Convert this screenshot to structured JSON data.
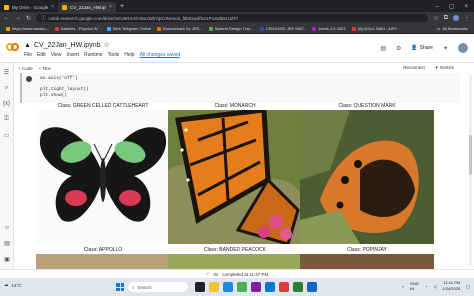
{
  "browser": {
    "tabs": [
      {
        "title": "My Drive - Google Drive",
        "active": false,
        "favicon_color": "#fbbc04"
      },
      {
        "title": "CV_22Jan_HW.ipynb - Colab",
        "active": true,
        "favicon_color": "#f9ab00"
      }
    ],
    "new_tab": "+",
    "url": "colab.research.google.com/drive/1KU6RXAD-Bsn3Zk7grL0Ne1ea_f8b0xwdfSn1P1swbB4UZFf",
    "bookmarks": [
      {
        "label": "https://www.amazo...",
        "color": "#ff9900"
      },
      {
        "label": "Batches - Physics W...",
        "color": "#e53935"
      },
      {
        "label": "Web Telegram Online",
        "color": "#29b6f6"
      },
      {
        "label": "Bounceback for JEE...",
        "color": "#ef6c00"
      },
      {
        "label": "System Design Tuto...",
        "color": "#4caf50"
      },
      {
        "label": "CENGAGE JEE MAT...",
        "color": "#3949ab"
      },
      {
        "label": "Jarvis 2.0 2023",
        "color": "#9c27b0"
      },
      {
        "label": "(8)(4)Su1-3d6rf - AIFF...",
        "color": "#e53935"
      }
    ],
    "all_bookmarks": "All Bookmarks"
  },
  "colab": {
    "notebook_title": "CV_22Jan_HW.ipynb",
    "menu": [
      "File",
      "Edit",
      "View",
      "Insert",
      "Runtime",
      "Tools",
      "Help"
    ],
    "saved_status": "All changes saved",
    "share_label": "Share",
    "toolbar": {
      "code": "+ Code",
      "text": "+ Text",
      "reconnect": "Reconnect",
      "gemini": "Gemini"
    }
  },
  "code_cell": {
    "lines": [
      "ax.axis('off')",
      "plt.tight_layout()",
      "plt.show()"
    ]
  },
  "output_grid": [
    {
      "caption": "Class: GREEN CELLED CATTLEHEART",
      "kind": "cattleheart"
    },
    {
      "caption": "Class: MONARCH",
      "kind": "monarch"
    },
    {
      "caption": "Class: QUESTION MARK",
      "kind": "questionmark"
    },
    {
      "caption": "Class: APPOLLO",
      "kind": "apollo"
    },
    {
      "caption": "Class: BANDED PEACOCK",
      "kind": "peacock"
    },
    {
      "caption": "Class: POPINJAY",
      "kind": "popinjay"
    }
  ],
  "statusbar": {
    "check": "✓",
    "duration": "0s",
    "completed": "completed at 11:37 PM"
  },
  "taskbar": {
    "search_placeholder": "Search",
    "weather": "14°C",
    "lang": "ENG",
    "region": "IN",
    "time": "11:41 PM",
    "date": "1/24/2025"
  }
}
